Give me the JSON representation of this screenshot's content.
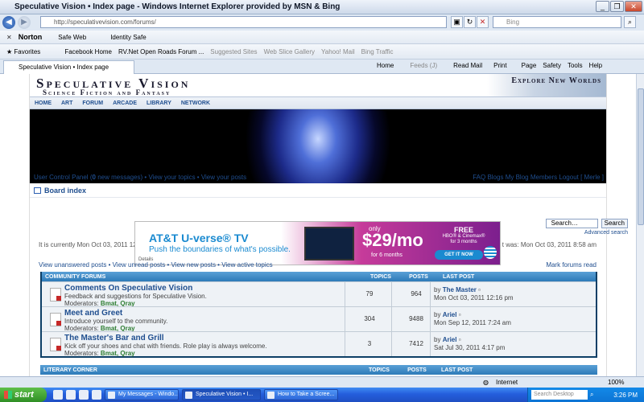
{
  "window": {
    "title": "Speculative Vision • Index page - Windows Internet Explorer provided by MSN & Bing"
  },
  "address": {
    "url": "http://speculativevision.com/forums/",
    "search_placeholder": "Bing"
  },
  "norton": {
    "brand": "Norton",
    "safe_web": "Safe Web",
    "identity_safe": "Identity Safe"
  },
  "favorites": {
    "label": "Favorites",
    "items": [
      "Facebook Home",
      "RV.Net Open Roads Forum ...",
      "Suggested Sites",
      "Web Slice Gallery",
      "Yahoo! Mail",
      "Bing Traffic"
    ]
  },
  "tab": {
    "label": "Speculative Vision • Index page"
  },
  "cmdbar": {
    "home": "Home",
    "feeds": "Feeds (J)",
    "read_mail": "Read Mail",
    "print": "Print",
    "page": "Page",
    "safety": "Safety",
    "tools": "Tools",
    "help": "Help"
  },
  "site": {
    "logo_title": "Speculative Vision",
    "logo_sub": "Science Fiction and Fantasy",
    "explore": "Explore New Worlds",
    "nav": [
      "HOME",
      "ART",
      "FORUM",
      "ARCADE",
      "LIBRARY",
      "NETWORK"
    ],
    "board_index": "Board index"
  },
  "userbar": {
    "ucp": "User Control Panel",
    "new_messages_count": "0",
    "new_messages_text": "new messages",
    "your_topics": "View your topics",
    "your_posts": "View your posts",
    "faq": "FAQ",
    "blogs": "Blogs",
    "my_blog": "My Blog",
    "members": "Members",
    "logout": "Logout [ Merle ]"
  },
  "search": {
    "placeholder": "Search…",
    "button": "Search",
    "advanced": "Advanced search"
  },
  "time": {
    "current": "It is currently Mon Oct 03, 2011 12:24 pm",
    "last_visit": "t was: Mon Oct 03, 2011 8:58 am"
  },
  "quicklinks": {
    "text": "View unanswered posts • View unread posts • View new posts • View active topics",
    "mark_read": "Mark forums read"
  },
  "ad": {
    "headline": "AT&T U-verse® TV",
    "tagline": "Push the boundaries of what's possible.",
    "only": "only",
    "price": "$29/mo",
    "duration": "for 6 months",
    "free": "FREE",
    "free_sub": "HBO® & Cinemax® for 3 months",
    "cta": "GET IT NOW",
    "details": "Details"
  },
  "forums": {
    "header": {
      "title": "COMMUNITY FORUMS",
      "topics": "TOPICS",
      "posts": "POSTS",
      "last_post": "LAST POST"
    },
    "rows": [
      {
        "title": "Comments On Speculative Vision",
        "desc": "Feedback and suggestions for Speculative Vision.",
        "moderators_label": "Moderators:",
        "moderators": "Bmat, Qray",
        "topics": "79",
        "posts": "964",
        "by": "by",
        "author": "The Master",
        "date": "Mon Oct 03, 2011 12:16 pm"
      },
      {
        "title": "Meet and Greet",
        "desc": "Introduce yourself to the community.",
        "moderators_label": "Moderators:",
        "moderators": "Bmat, Qray",
        "topics": "304",
        "posts": "9488",
        "by": "by",
        "author": "Ariel",
        "date": "Mon Sep 12, 2011 7:24 am"
      },
      {
        "title": "The Master's Bar and Grill",
        "desc": "Kick off your shoes and chat with friends. Role play is always welcome.",
        "moderators_label": "Moderators:",
        "moderators": "Bmat, Qray",
        "topics": "3",
        "posts": "7412",
        "by": "by",
        "author": "Ariel",
        "date": "Sat Jul 30, 2011 4:17 pm"
      }
    ],
    "next_header": {
      "title": "LITERARY CORNER",
      "topics": "TOPICS",
      "posts": "POSTS",
      "last_post": "LAST POST"
    }
  },
  "status": {
    "zone": "Internet",
    "zoom": "100%"
  },
  "taskbar": {
    "start": "start",
    "buttons": [
      "My Messages - Windo...",
      "Speculative Vision • I...",
      "How to Take a Scree..."
    ],
    "search_desktop": "Search Desktop",
    "clock": "3:26 PM"
  }
}
